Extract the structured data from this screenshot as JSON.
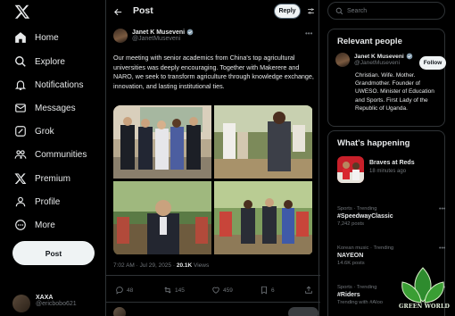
{
  "nav": {
    "items": [
      {
        "label": "Home",
        "icon": "home-icon"
      },
      {
        "label": "Explore",
        "icon": "search-icon"
      },
      {
        "label": "Notifications",
        "icon": "bell-icon"
      },
      {
        "label": "Messages",
        "icon": "mail-icon"
      },
      {
        "label": "Grok",
        "icon": "grok-icon"
      },
      {
        "label": "Communities",
        "icon": "communities-icon"
      },
      {
        "label": "Premium",
        "icon": "x-logo-icon"
      },
      {
        "label": "Profile",
        "icon": "person-icon"
      },
      {
        "label": "More",
        "icon": "more-circle-icon"
      }
    ],
    "post_label": "Post",
    "account": {
      "name": "XAXA",
      "handle": "@ericbobo621"
    }
  },
  "header": {
    "title": "Post",
    "reply_label": "Reply"
  },
  "post": {
    "author_name": "Janet K Museveni",
    "author_handle": "@JanetMuseveni",
    "text": "Our meeting with senior academics from China's top agricultural universities was deeply encouraging. Together with Makerere and NARO, we seek to transform agriculture through knowledge exchange, innovation, and lasting institutional ties.",
    "time": "7:02 AM · Jul 29, 2025 · ",
    "views_count": "20.1K",
    "views_label": " Views",
    "replies": "48",
    "reposts": "145",
    "likes": "459",
    "bookmarks": "6"
  },
  "right": {
    "search_placeholder": "Search",
    "relevant": {
      "title": "Relevant people",
      "name": "Janet K Museveni",
      "handle": "@JanetMuseveni",
      "follow_label": "Follow",
      "bio": "Christian. Wife. Mother. Grandmother. Founder of UWESO. Minister of Education and Sports. First Lady of the Republic of Uganda."
    },
    "happening": {
      "title": "What's happening",
      "event_title": "Braves at Reds",
      "event_time": "18 minutes ago",
      "trends": [
        {
          "context": "Sports · Trending",
          "name": "#SpeedwayClassic",
          "posts": "7,242 posts"
        },
        {
          "context": "Korean music · Trending",
          "name": "NAYEON",
          "posts": "14.6K posts"
        },
        {
          "context": "Sports · Trending",
          "name": "#Riders",
          "posts": "Trending with #Aloo"
        }
      ]
    }
  },
  "watermark": {
    "text": "GREEN WORLD"
  },
  "colors": {
    "background": "#000000",
    "text": "#e7e9ea",
    "muted": "#71767b",
    "accent": "#1d9bf0",
    "border": "#2f3336"
  }
}
